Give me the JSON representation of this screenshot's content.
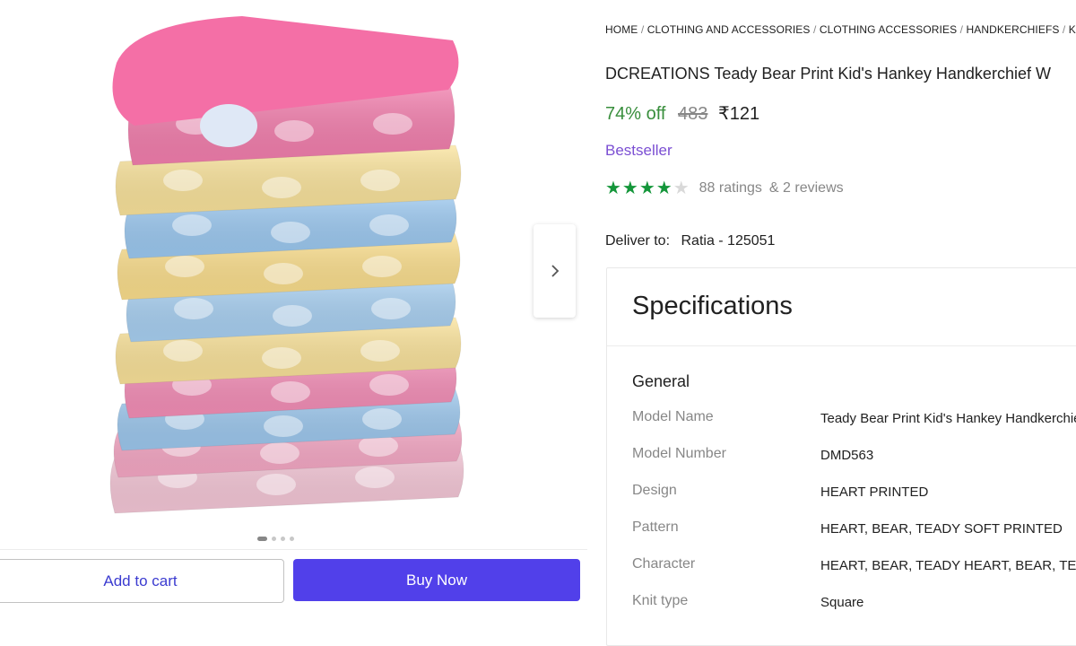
{
  "gallery": {
    "next_icon": "chevron-right-icon",
    "dots_count": 4,
    "active_dot": 0
  },
  "actions": {
    "add_to_cart": "Add to cart",
    "buy_now": "Buy Now"
  },
  "breadcrumb": [
    "HOME",
    "CLOTHING AND ACCESSORIES",
    "CLOTHING ACCESSORIES",
    "HANDKERCHIEFS",
    "KIDS"
  ],
  "breadcrumb_sep": "/",
  "product": {
    "title": "DCREATIONS Teady Bear Print Kid's Hankey Handkerchief W",
    "discount": "74% off",
    "mrp": "483",
    "price": "₹121",
    "badge": "Bestseller",
    "rating": 4,
    "rating_stars_total": 5,
    "ratings_text": "88 ratings",
    "reviews_text": "& 2 reviews"
  },
  "delivery": {
    "label": "Deliver to:",
    "location": "Ratia - 125051"
  },
  "specifications": {
    "title": "Specifications",
    "section": "General",
    "rows": [
      {
        "key": "Model Name",
        "value": "Teady Bear Print Kid's Hankey Handkerchief"
      },
      {
        "key": "Model Number",
        "value": "DMD563"
      },
      {
        "key": "Design",
        "value": "HEART PRINTED"
      },
      {
        "key": "Pattern",
        "value": "HEART, BEAR, TEADY SOFT PRINTED"
      },
      {
        "key": "Character",
        "value": "HEART, BEAR, TEADY HEART, BEAR, TEADY"
      },
      {
        "key": "Knit type",
        "value": "Square"
      }
    ]
  },
  "colors": {
    "accent_buy": "#5140ea",
    "discount_green": "#388e3c",
    "star_green": "#14963a",
    "bestseller_purple": "#7b4fd3",
    "link_blue": "#3b3bd0"
  }
}
